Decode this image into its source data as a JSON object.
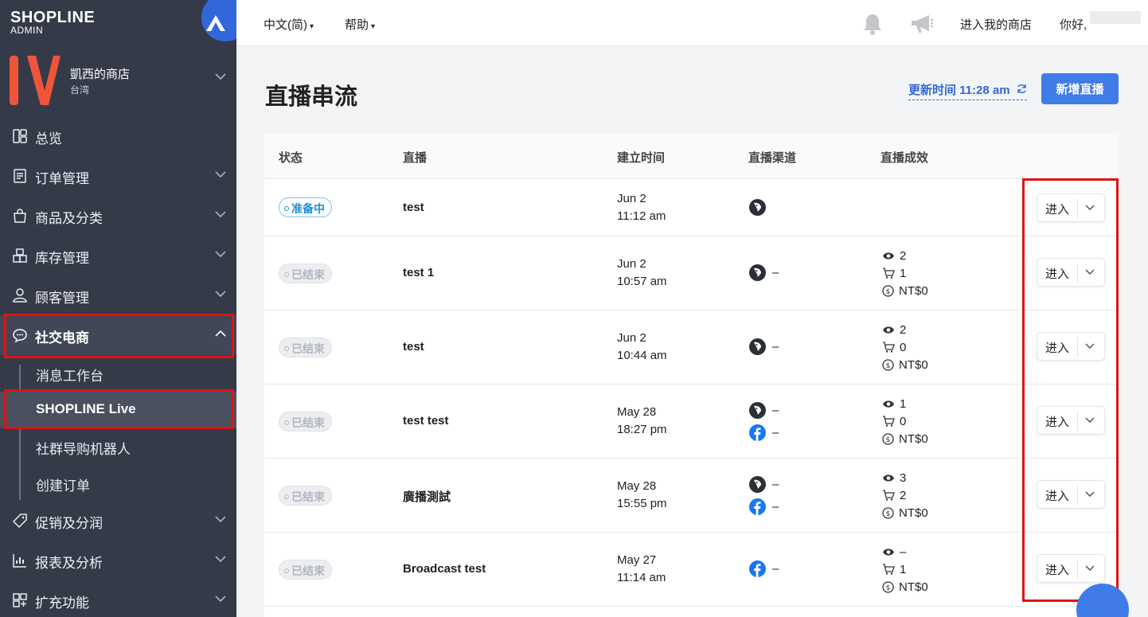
{
  "sidebar": {
    "brand": "SHOPLINE",
    "brand_sub": "ADMIN",
    "store_name": "凱西的商店",
    "store_region": "台湾",
    "nav": [
      {
        "label": "总览",
        "icon": "dashboard-icon"
      },
      {
        "label": "订单管理",
        "icon": "orders-icon"
      },
      {
        "label": "商品及分类",
        "icon": "products-icon"
      },
      {
        "label": "库存管理",
        "icon": "inventory-icon"
      },
      {
        "label": "顾客管理",
        "icon": "customers-icon"
      },
      {
        "label": "社交电商",
        "icon": "chat-icon"
      }
    ],
    "sub_nav": [
      "消息工作台",
      "SHOPLINE Live",
      "社群导购机器人",
      "创建订单"
    ],
    "nav_after": [
      {
        "label": "促销及分润",
        "icon": "tag-icon"
      },
      {
        "label": "报表及分析",
        "icon": "report-icon"
      },
      {
        "label": "扩充功能",
        "icon": "apps-icon"
      }
    ]
  },
  "topbar": {
    "language": "中文(简)",
    "help": "帮助",
    "enter_store": "进入我的商店",
    "greeting": "你好,"
  },
  "page": {
    "title": "直播串流",
    "update_time": "更新时间 11:28 am",
    "new_button": "新增直播"
  },
  "table": {
    "headers": [
      "状态",
      "直播",
      "建立时间",
      "直播渠道",
      "直播成效"
    ],
    "enter_label": "进入",
    "rows": [
      {
        "status": "准备中",
        "status_type": "ready",
        "name": "test",
        "date": "Jun 2",
        "time": "11:12 am",
        "channels": [
          {
            "type": "shopline",
            "value": ""
          }
        ],
        "stats": null
      },
      {
        "status": "已结束",
        "status_type": "ended",
        "name": "test 1",
        "date": "Jun 2",
        "time": "10:57 am",
        "channels": [
          {
            "type": "shopline",
            "value": "–"
          }
        ],
        "stats": {
          "views": "2",
          "carts": "1",
          "revenue": "NT$0"
        }
      },
      {
        "status": "已结束",
        "status_type": "ended",
        "name": "test",
        "date": "Jun 2",
        "time": "10:44 am",
        "channels": [
          {
            "type": "shopline",
            "value": "–"
          }
        ],
        "stats": {
          "views": "2",
          "carts": "0",
          "revenue": "NT$0"
        }
      },
      {
        "status": "已结束",
        "status_type": "ended",
        "name": "test test",
        "date": "May 28",
        "time": "18:27 pm",
        "channels": [
          {
            "type": "shopline",
            "value": "–"
          },
          {
            "type": "facebook",
            "value": "–"
          }
        ],
        "stats": {
          "views": "1",
          "carts": "0",
          "revenue": "NT$0"
        }
      },
      {
        "status": "已结束",
        "status_type": "ended",
        "name": "廣播測試",
        "date": "May 28",
        "time": "15:55 pm",
        "channels": [
          {
            "type": "shopline",
            "value": "–"
          },
          {
            "type": "facebook",
            "value": "–"
          }
        ],
        "stats": {
          "views": "3",
          "carts": "2",
          "revenue": "NT$0"
        }
      },
      {
        "status": "已结束",
        "status_type": "ended",
        "name": "Broadcast test",
        "date": "May 27",
        "time": "11:14 am",
        "channels": [
          {
            "type": "facebook",
            "value": "–"
          }
        ],
        "stats": {
          "views": "–",
          "carts": "1",
          "revenue": "NT$0"
        }
      }
    ]
  },
  "colors": {
    "sidebar_bg": "#353a48",
    "accent": "#3f7ce8",
    "highlight": "#e01212",
    "store_logo": "#f0553a"
  }
}
